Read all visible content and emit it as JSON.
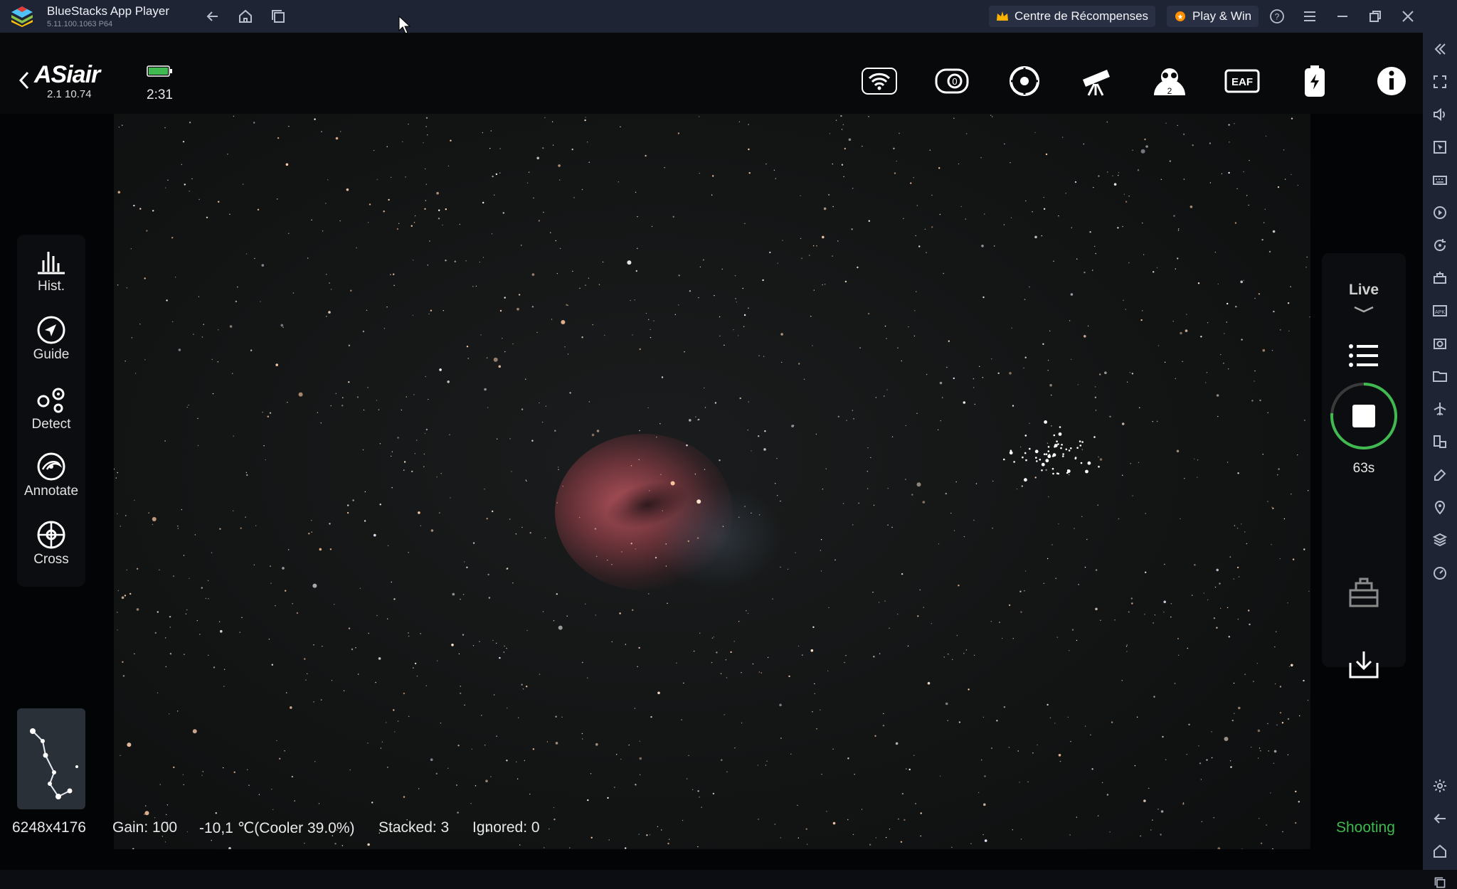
{
  "window": {
    "title": "BlueStacks App Player",
    "version": "5.11.100.1063  P64",
    "rewards_label": "Centre de  Récompenses",
    "playwin_label": "Play & Win"
  },
  "app": {
    "logo_text": "ASiair",
    "version": "2.1 10.74",
    "battery_time": "2:31"
  },
  "left_tools": [
    {
      "label": "Hist.",
      "icon": "histogram-icon"
    },
    {
      "label": "Guide",
      "icon": "guide-icon"
    },
    {
      "label": "Detect",
      "icon": "detect-icon"
    },
    {
      "label": "Annotate",
      "icon": "annotate-icon"
    },
    {
      "label": "Cross",
      "icon": "crosshair-icon"
    }
  ],
  "right_panel": {
    "mode_label": "Live",
    "timer": "63s"
  },
  "status": {
    "resolution": "6248x4176",
    "gain": "Gain: 100",
    "temperature": "-10,1 ℃(Cooler 39.0%)",
    "stacked": "Stacked: 3",
    "ignored": "Ignored: 0",
    "state": "Shooting"
  },
  "colors": {
    "accent_green": "#3fb950",
    "titlebar": "#1f2434"
  }
}
